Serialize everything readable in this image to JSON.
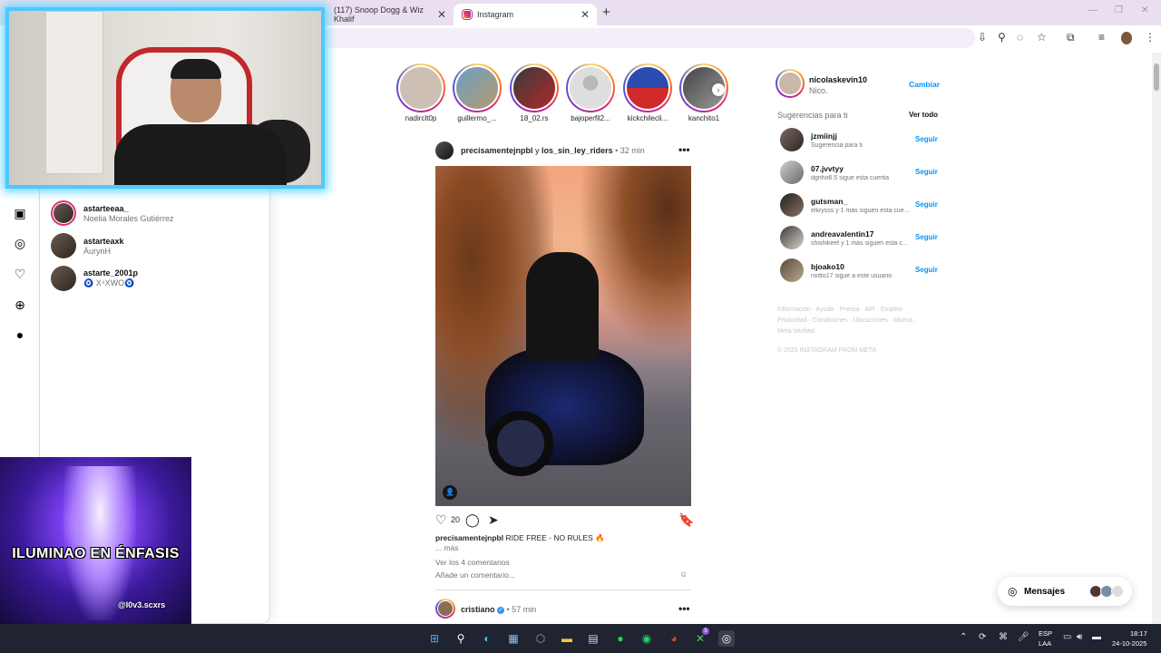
{
  "browser": {
    "tabs": [
      {
        "label": "(117) Snoop Dogg & Wiz Khalif"
      },
      {
        "label": "Instagram"
      }
    ],
    "new_tab_label": "+",
    "close_glyph": "✕"
  },
  "search_panel": {
    "results": [
      {
        "username": "astarteeaa_",
        "subtitle": "Noelia Morales Gutiérrez"
      },
      {
        "username": "astarteaxk",
        "subtitle": "ÁurynH"
      },
      {
        "username": "astarte_2001p",
        "subtitle": "🧿 X⁴XWO🧿"
      }
    ]
  },
  "overlay": {
    "title": "ILUMINAO EN ÉNFASIS",
    "handle": "@l0v3.scxrs"
  },
  "stories": [
    {
      "name": "nadirclt0p",
      "seen": false
    },
    {
      "name": "guillermo_...",
      "seen": false
    },
    {
      "name": "18_02.rs",
      "seen": false
    },
    {
      "name": "bajoperfil2...",
      "seen": true
    },
    {
      "name": "kickchilecli...",
      "seen": false
    },
    {
      "name": "kanchito1",
      "seen": false
    }
  ],
  "post": {
    "author1": "precisamentejnpbl",
    "joiner": " y ",
    "author2": "los_sin_ley_riders",
    "time": " • 32 min",
    "likes": "20",
    "caption_user": "precisamentejnpbl",
    "caption_text": " RIDE FREE - NO RULES 🔥",
    "more": "... más",
    "view_comments": "Ver los 4 comentarios",
    "add_comment": "Añade un comentario..."
  },
  "post2": {
    "user": "cristiano",
    "time": " • 57 min"
  },
  "profile": {
    "username": "nicolaskevin10",
    "name": "Nico.",
    "switch": "Cambiar"
  },
  "suggestions": {
    "title": "Sugerencias para ti",
    "see_all": "Ver todo",
    "follow": "Seguir",
    "items": [
      {
        "username": "jzmiinjj",
        "desc": "Sugerencia para ti"
      },
      {
        "username": "07.jvvtyy",
        "desc": "dgnho6.5 sigue esta cuenta"
      },
      {
        "username": "gutsman_",
        "desc": "elkrysss y 1 más siguen esta cuenta"
      },
      {
        "username": "andreavalentin17",
        "desc": "shishikeef y 1 más siguen esta cuenta"
      },
      {
        "username": "bjoako10",
        "desc": "nxitto17 sigue a este usuario"
      }
    ],
    "footer": [
      "Información · Ayuda · Prensa · API · Empleo ·",
      "Privacidad · Condiciones · Ubicaciones · Idioma ·",
      "Meta Verified",
      "© 2025 INSTAGRAM FROM META"
    ]
  },
  "messages": {
    "label": "Mensajes"
  },
  "taskbar": {
    "lang": "ESP",
    "layout": "LAA",
    "time": "18:17",
    "date": "24-10-2025",
    "spotify_badge": "5"
  },
  "colors": {
    "accent": "#0095f6",
    "ig_gradient": [
      "#feda75",
      "#fa7e1e",
      "#d62976",
      "#962fbf",
      "#4f5bd5"
    ]
  }
}
